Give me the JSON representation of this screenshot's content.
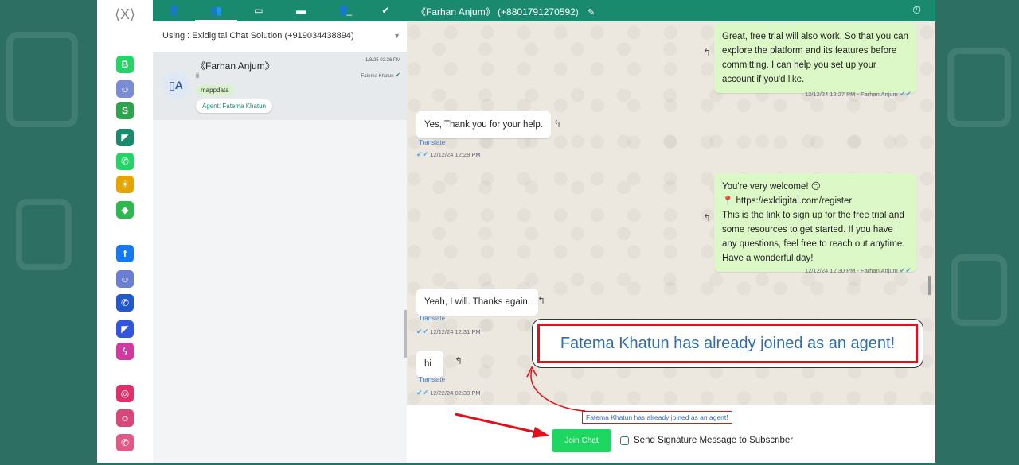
{
  "rail": {
    "logo": "⟨X⟩",
    "icons": [
      {
        "name": "whatsapp-business-icon",
        "glyph": "B",
        "color": "#25d366"
      },
      {
        "name": "chatbot-icon",
        "glyph": "☺",
        "color": "#7b8cd6"
      },
      {
        "name": "green-doc-icon",
        "glyph": "S",
        "color": "#2ea44f"
      },
      {
        "name": "megaphone-icon",
        "glyph": "◤",
        "color": "#1a8a6f"
      },
      {
        "name": "whatsapp-icon",
        "glyph": "✆",
        "color": "#25d366"
      },
      {
        "name": "automation-icon",
        "glyph": "☀",
        "color": "#e6a400"
      },
      {
        "name": "shopping-bag-icon",
        "glyph": "◆",
        "color": "#2fb84f"
      },
      {
        "name": "facebook-icon",
        "glyph": "f",
        "color": "#1877f2"
      },
      {
        "name": "messenger-bot-icon",
        "glyph": "☺",
        "color": "#6a7fd1"
      },
      {
        "name": "phone-doc-icon",
        "glyph": "✆",
        "color": "#2458c9"
      },
      {
        "name": "campaign-icon",
        "glyph": "◤",
        "color": "#3355dd"
      },
      {
        "name": "messenger-icon",
        "glyph": "ϟ",
        "color": "#d03a9e"
      },
      {
        "name": "instagram-icon",
        "glyph": "◎",
        "color": "#e0306a"
      },
      {
        "name": "insta-bot-icon",
        "glyph": "☺",
        "color": "#d9477a"
      },
      {
        "name": "insta-phone-icon",
        "glyph": "✆",
        "color": "#e05a86"
      }
    ]
  },
  "list": {
    "tabs": [
      "👤",
      "👥",
      "▭",
      "▬",
      "👤̲",
      "✔"
    ],
    "using_label": "Using : Exldigital Chat Solution (+919034438894)",
    "caret": "▼",
    "conversation": {
      "avatar": "▯A",
      "name": "《Farhan Anjum》",
      "preview": "ii",
      "tag": "mappdata",
      "agent": "Agent: Fatema Khatun",
      "time": "1/8/25 02:36 PM",
      "assigned": "Fatema Khatun",
      "tick": "✔"
    }
  },
  "chat": {
    "header_title": "《Farhan Anjum》 (+8801791270592)",
    "edit_icon": "✎",
    "stopwatch_icon": "⏱",
    "messages": [
      {
        "text": "Great, free trial will also work. So that you can explore the platform and its features before committing. I can help you set up your account if you'd like.",
        "meta": "12/12/24 12:27 PM - Farhan Anjum",
        "tick": "✔✔"
      },
      {
        "text": "Yes, Thank you for your help.",
        "translate": "Translate",
        "meta": "12/12/24 12:28 PM",
        "tick": "✔✔"
      },
      {
        "line1": "You're very welcome! 😊",
        "line2": "📍 https://exldigital.com/register",
        "line3": "This is the link to sign up for the free trial and some resources to get started. If you have any questions, feel free to reach out anytime. Have a wonderful day!",
        "meta": "12/12/24 12:30 PM - Farhan Anjum",
        "tick": "✔✔"
      },
      {
        "text": "Yeah, I will. Thanks again.",
        "translate": "Translate",
        "meta": "12/12/24 12:31 PM",
        "tick": "✔✔"
      },
      {
        "text": "hi",
        "translate": "Translate",
        "meta": "12/22/24 02:33 PM",
        "tick": "✔✔"
      }
    ],
    "reply_glyph": "↰",
    "callout_text": "Fatema Khatun has already joined as an agent!",
    "notice_text": "Fatema Khatun has already joined as an agent!",
    "join_button": "Join Chat",
    "signature_label": "Send Signature Message to Subscriber"
  },
  "colors": {
    "brand": "#1a8a6f",
    "join": "#1ed760",
    "highlight": "#e0101c"
  }
}
